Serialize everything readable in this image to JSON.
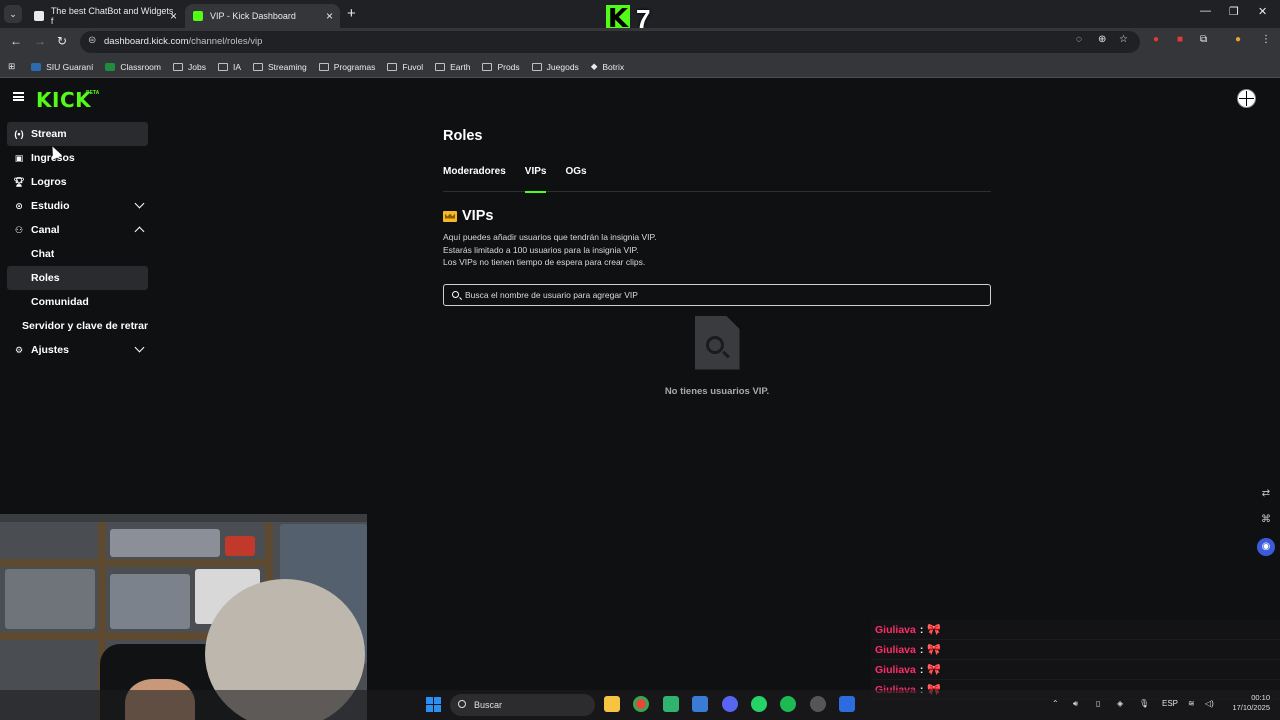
{
  "browser": {
    "tabs": [
      {
        "title": "The best ChatBot and Widgets f",
        "active": false
      },
      {
        "title": "VIP - Kick Dashboard",
        "active": true
      }
    ],
    "url_host": "dashboard.kick.com",
    "url_path": "/channel/roles/vip",
    "bookmarks": [
      "SIU Guaraní",
      "Classroom",
      "Jobs",
      "IA",
      "Streaming",
      "Programas",
      "Fuvol",
      "Earth",
      "Prods",
      "Juegods",
      "Botrix"
    ],
    "overlay_number": "7"
  },
  "header": {
    "logo": "KICK",
    "beta": "BETA"
  },
  "sidebar": {
    "items": [
      {
        "label": "Stream",
        "icon": "broadcast-icon",
        "active": true
      },
      {
        "label": "Ingresos",
        "icon": "wallet-icon"
      },
      {
        "label": "Logros",
        "icon": "trophy-icon"
      },
      {
        "label": "Estudio",
        "icon": "studio-icon",
        "chevron": "down"
      },
      {
        "label": "Canal",
        "icon": "channel-icon",
        "chevron": "up"
      },
      {
        "label": "Chat",
        "sub": true
      },
      {
        "label": "Roles",
        "sub": true,
        "selected": true
      },
      {
        "label": "Comunidad",
        "sub": true
      },
      {
        "label": "Servidor y clave de retransmisión",
        "sub": true
      },
      {
        "label": "Ajustes",
        "icon": "gear-icon",
        "chevron": "down"
      }
    ]
  },
  "main": {
    "title": "Roles",
    "tabs": [
      "Moderadores",
      "VIPs",
      "OGs"
    ],
    "active_tab": "VIPs",
    "section_title": "VIPs",
    "description": [
      "Aquí puedes añadir usuarios que tendrán la insignia VIP.",
      "Estarás limitado a 100 usuarios para la insignia VIP.",
      "Los VIPs no tienen tiempo de espera para crear clips."
    ],
    "search_placeholder": "Busca el nombre de usuario para agregar VIP",
    "empty_text": "No tienes usuarios VIP."
  },
  "chat_overlay": [
    {
      "user": "Giuliava",
      "sep": ":",
      "emote": "🎀"
    },
    {
      "user": "Giuliava",
      "sep": ":",
      "emote": "🎀"
    },
    {
      "user": "Giuliava",
      "sep": ":",
      "emote": "🎀"
    },
    {
      "user": "Giuliava",
      "sep": ":",
      "emote": "🎀"
    }
  ],
  "taskbar": {
    "search_label": "Buscar",
    "lang": "ESP",
    "time": "00:10",
    "date": "17/10/2025"
  },
  "colors": {
    "accent": "#53fc18",
    "chat_user": "#ff2d6a"
  }
}
